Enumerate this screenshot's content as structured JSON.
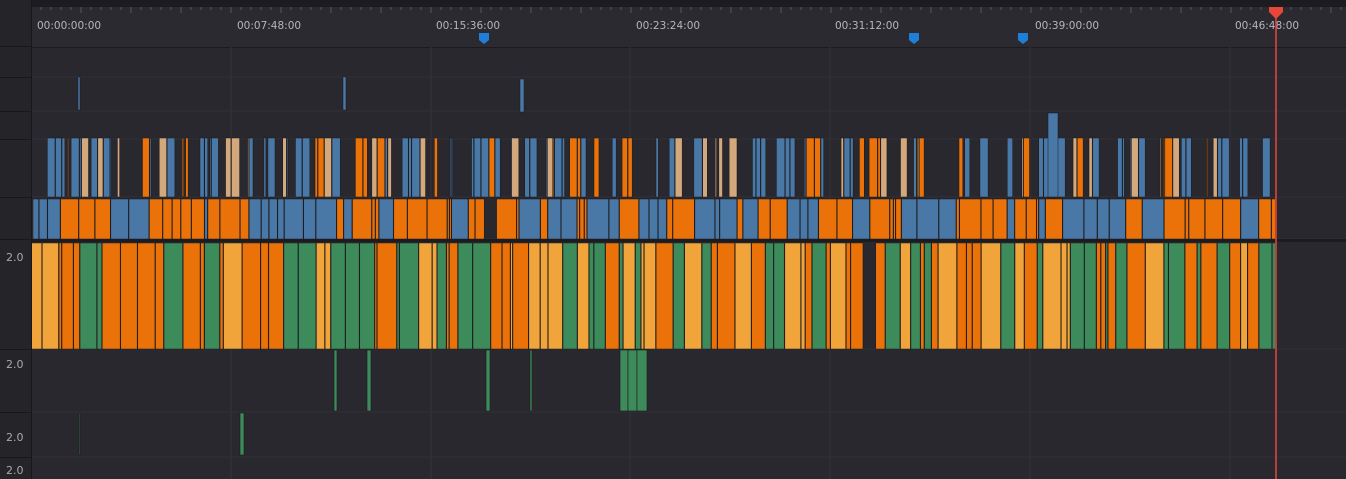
{
  "ruler": {
    "timecodes": [
      "00:00:00:00",
      "00:07:48:00",
      "00:15:36:00",
      "00:23:24:00",
      "00:31:12:00",
      "00:39:00:00",
      "00:46:48:00"
    ]
  },
  "tracks": {
    "audio_levels": [
      "2.0",
      "2.0",
      "2.0",
      "2.0"
    ]
  },
  "colors": {
    "blue": "#4a78a6",
    "orange": "#ea7208",
    "tan": "#d2a87c",
    "green": "#3d8a5b",
    "light_orange": "#f0a43a",
    "playhead": "#e8463b",
    "marker": "#1f7fd8"
  },
  "timeline": {
    "markers_count": 3,
    "playhead_timecode": "00:46:48:00"
  }
}
